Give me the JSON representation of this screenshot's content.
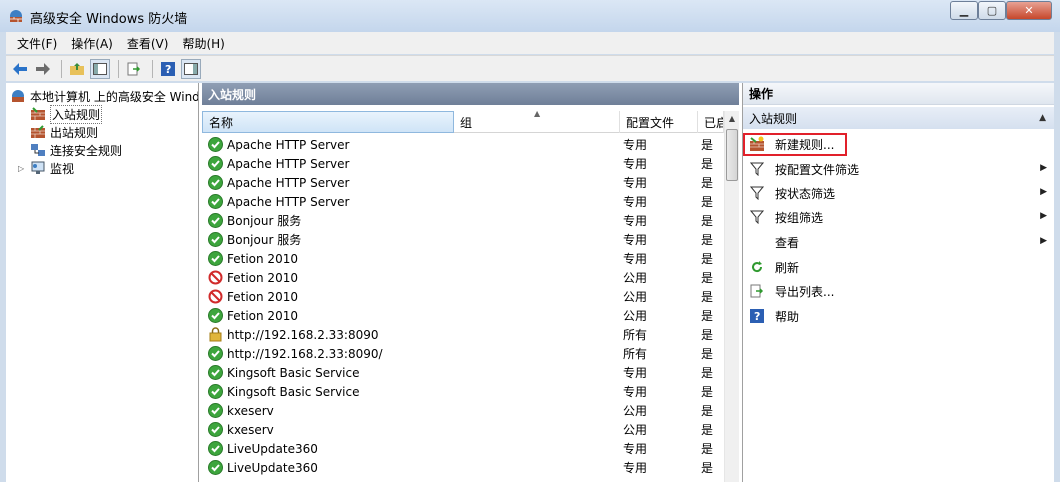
{
  "window": {
    "title": "高级安全 Windows 防火墙"
  },
  "menu": [
    "文件(F)",
    "操作(A)",
    "查看(V)",
    "帮助(H)"
  ],
  "tree": {
    "root": "本地计算机 上的高级安全 Windows 防火墙",
    "items": [
      "入站规则",
      "出站规则",
      "连接安全规则",
      "监视"
    ]
  },
  "center": {
    "title": "入站规则",
    "columns": {
      "name": "名称",
      "group": "组",
      "profile": "配置文件",
      "enabled": "已启用"
    },
    "rows": [
      {
        "name": "Apache HTTP Server",
        "profile": "专用",
        "enabled": "是",
        "icon": "allow"
      },
      {
        "name": "Apache HTTP Server",
        "profile": "专用",
        "enabled": "是",
        "icon": "allow"
      },
      {
        "name": "Apache HTTP Server",
        "profile": "专用",
        "enabled": "是",
        "icon": "allow"
      },
      {
        "name": "Apache HTTP Server",
        "profile": "专用",
        "enabled": "是",
        "icon": "allow"
      },
      {
        "name": "Bonjour 服务",
        "profile": "专用",
        "enabled": "是",
        "icon": "allow"
      },
      {
        "name": "Bonjour 服务",
        "profile": "专用",
        "enabled": "是",
        "icon": "allow"
      },
      {
        "name": "Fetion 2010",
        "profile": "专用",
        "enabled": "是",
        "icon": "allow"
      },
      {
        "name": "Fetion 2010",
        "profile": "公用",
        "enabled": "是",
        "icon": "block"
      },
      {
        "name": "Fetion 2010",
        "profile": "公用",
        "enabled": "是",
        "icon": "block"
      },
      {
        "name": "Fetion 2010",
        "profile": "公用",
        "enabled": "是",
        "icon": "allow"
      },
      {
        "name": "http://192.168.2.33:8090",
        "profile": "所有",
        "enabled": "是",
        "icon": "lock"
      },
      {
        "name": "http://192.168.2.33:8090/",
        "profile": "所有",
        "enabled": "是",
        "icon": "allow"
      },
      {
        "name": "Kingsoft Basic Service",
        "profile": "专用",
        "enabled": "是",
        "icon": "allow"
      },
      {
        "name": "Kingsoft Basic Service",
        "profile": "专用",
        "enabled": "是",
        "icon": "allow"
      },
      {
        "name": "kxeserv",
        "profile": "公用",
        "enabled": "是",
        "icon": "allow"
      },
      {
        "name": "kxeserv",
        "profile": "公用",
        "enabled": "是",
        "icon": "allow"
      },
      {
        "name": "LiveUpdate360",
        "profile": "专用",
        "enabled": "是",
        "icon": "allow"
      },
      {
        "name": "LiveUpdate360",
        "profile": "专用",
        "enabled": "是",
        "icon": "allow"
      }
    ]
  },
  "actions": {
    "title": "操作",
    "section": "入站规则",
    "items": [
      {
        "label": "新建规则...",
        "icon": "new-rule-icon",
        "submenu": false
      },
      {
        "label": "按配置文件筛选",
        "icon": "filter-icon",
        "submenu": true
      },
      {
        "label": "按状态筛选",
        "icon": "filter-icon",
        "submenu": true
      },
      {
        "label": "按组筛选",
        "icon": "filter-icon",
        "submenu": true
      },
      {
        "label": "查看",
        "icon": "",
        "submenu": true
      },
      {
        "label": "刷新",
        "icon": "refresh-icon",
        "submenu": false
      },
      {
        "label": "导出列表...",
        "icon": "export-icon",
        "submenu": false
      },
      {
        "label": "帮助",
        "icon": "help-icon",
        "submenu": false
      }
    ]
  },
  "colors": {
    "header_dark": "#7f8ea6",
    "highlight_border": "#e1202a",
    "selection": "#cfe4f7"
  }
}
